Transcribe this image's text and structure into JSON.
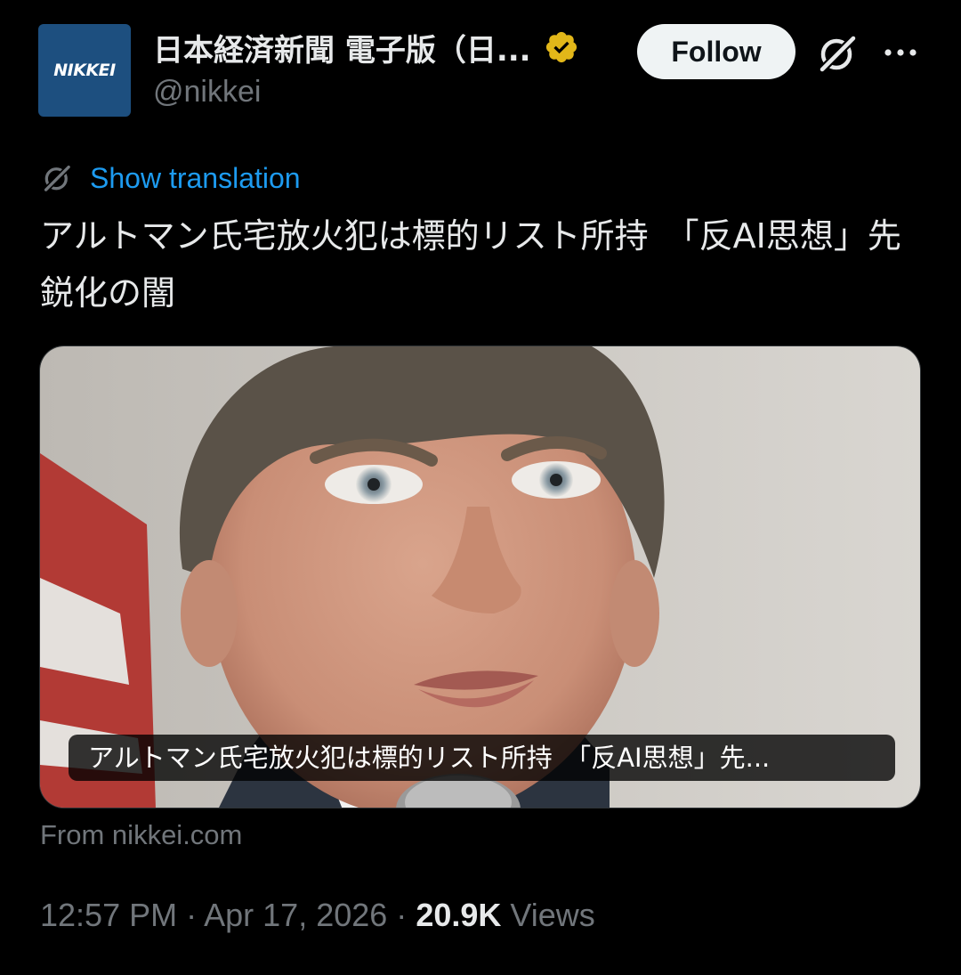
{
  "author": {
    "avatar_text": "NIKKEI",
    "display_name": "日本経済新聞 電子版（日...",
    "handle": "@nikkei",
    "verified_badge_color": "#e2b719"
  },
  "actions": {
    "follow_label": "Follow"
  },
  "translation": {
    "label": "Show translation"
  },
  "tweet": {
    "text": "アルトマン氏宅放火犯は標的リスト所持　「反AI思想」先鋭化の闇"
  },
  "card": {
    "caption": "アルトマン氏宅放火犯は標的リスト所持　「反AI思想」先...",
    "source": "From nikkei.com"
  },
  "meta": {
    "time": "12:57 PM",
    "separator_1": "·",
    "date": "Apr 17, 2026",
    "separator_2": "·",
    "views_count": "20.9K",
    "views_label": "Views"
  },
  "colors": {
    "background": "#000000",
    "text_primary": "#e7e9ea",
    "text_secondary": "#71767b",
    "link_blue": "#1d9bf0",
    "follow_bg": "#eff3f4",
    "avatar_bg": "#1d4f7f"
  },
  "icons": {
    "grok": "grok-icon",
    "more": "more-icon",
    "translate": "translate-icon",
    "verified": "verified-badge-icon"
  }
}
